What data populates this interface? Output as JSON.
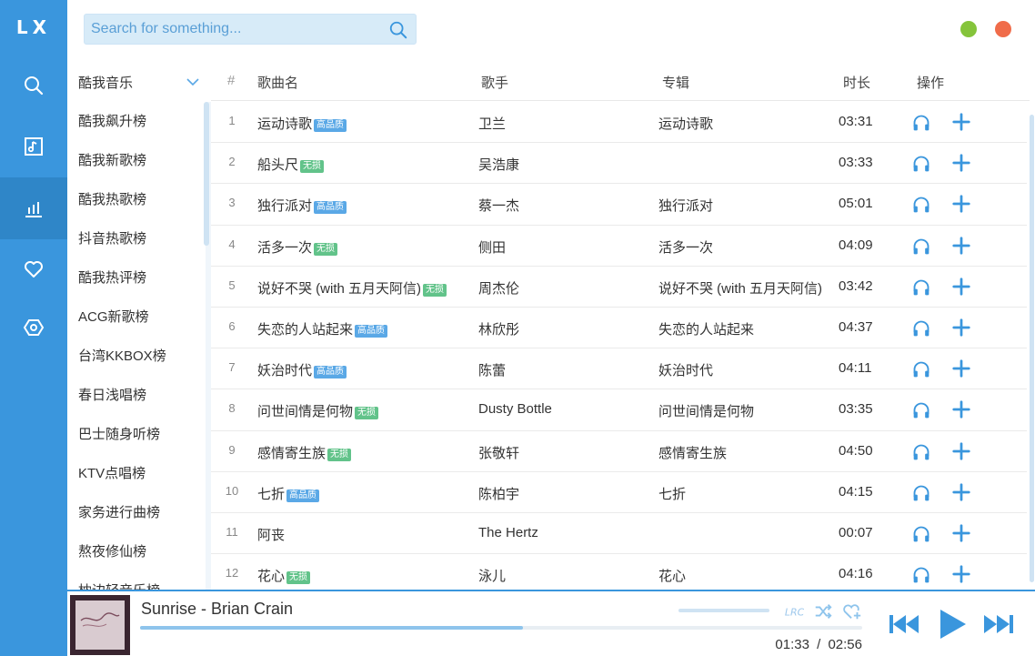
{
  "app": {
    "logo": "LX"
  },
  "search": {
    "placeholder": "Search for something..."
  },
  "source": {
    "selected": "酷我音乐",
    "items": [
      "酷我飙升榜",
      "酷我新歌榜",
      "酷我热歌榜",
      "抖音热歌榜",
      "酷我热评榜",
      "ACG新歌榜",
      "台湾KKBOX榜",
      "春日浅唱榜",
      "巴士随身听榜",
      "KTV点唱榜",
      "家务进行曲榜",
      "熬夜修仙榜",
      "枕边轻音乐榜"
    ]
  },
  "table": {
    "headers": {
      "num": "#",
      "name": "歌曲名",
      "singer": "歌手",
      "album": "专辑",
      "duration": "时长",
      "ops": "操作"
    },
    "rows": [
      {
        "num": "1",
        "name": "运动诗歌",
        "badge": "高品质",
        "badge_type": "hq",
        "singer": "卫兰",
        "album": "运动诗歌",
        "duration": "03:31"
      },
      {
        "num": "2",
        "name": "船头尺",
        "badge": "无损",
        "badge_type": "ls",
        "singer": "吴浩康",
        "album": "",
        "duration": "03:33"
      },
      {
        "num": "3",
        "name": "独行派对",
        "badge": "高品质",
        "badge_type": "hq",
        "singer": "蔡一杰",
        "album": "独行派对",
        "duration": "05:01"
      },
      {
        "num": "4",
        "name": "活多一次",
        "badge": "无损",
        "badge_type": "ls",
        "singer": "侧田",
        "album": "活多一次",
        "duration": "04:09"
      },
      {
        "num": "5",
        "name": "说好不哭 (with 五月天阿信)",
        "badge": "无损",
        "badge_type": "ls",
        "singer": "周杰伦",
        "album": "说好不哭 (with 五月天阿信)",
        "duration": "03:42"
      },
      {
        "num": "6",
        "name": "失恋的人站起来",
        "badge": "高品质",
        "badge_type": "hq",
        "singer": "林欣彤",
        "album": "失恋的人站起来",
        "duration": "04:37"
      },
      {
        "num": "7",
        "name": "妖治时代",
        "badge": "高品质",
        "badge_type": "hq",
        "singer": "陈蕾",
        "album": "妖治时代",
        "duration": "04:11"
      },
      {
        "num": "8",
        "name": "问世间情是何物",
        "badge": "无损",
        "badge_type": "ls",
        "singer": "Dusty Bottle",
        "album": "问世间情是何物",
        "duration": "03:35"
      },
      {
        "num": "9",
        "name": "感情寄生族",
        "badge": "无损",
        "badge_type": "ls",
        "singer": "张敬轩",
        "album": "感情寄生族",
        "duration": "04:50"
      },
      {
        "num": "10",
        "name": "七折",
        "badge": "高品质",
        "badge_type": "hq",
        "singer": "陈柏宇",
        "album": "七折",
        "duration": "04:15"
      },
      {
        "num": "11",
        "name": "阿丧",
        "badge": "",
        "badge_type": "",
        "singer": "The Hertz",
        "album": "",
        "duration": "00:07"
      },
      {
        "num": "12",
        "name": "花心",
        "badge": "无损",
        "badge_type": "ls",
        "singer": "泳儿",
        "album": "花心",
        "duration": "04:16"
      }
    ]
  },
  "player": {
    "title": "Sunrise - Brian Crain",
    "current_time": "01:33",
    "separator": "/",
    "total_time": "02:56",
    "progress": 0.53,
    "volume": 1.0,
    "lrc_label": "LRC"
  },
  "colors": {
    "accent": "#3a96dd",
    "hq_badge": "#5aa8e6",
    "lossless_badge": "#62c38a"
  }
}
